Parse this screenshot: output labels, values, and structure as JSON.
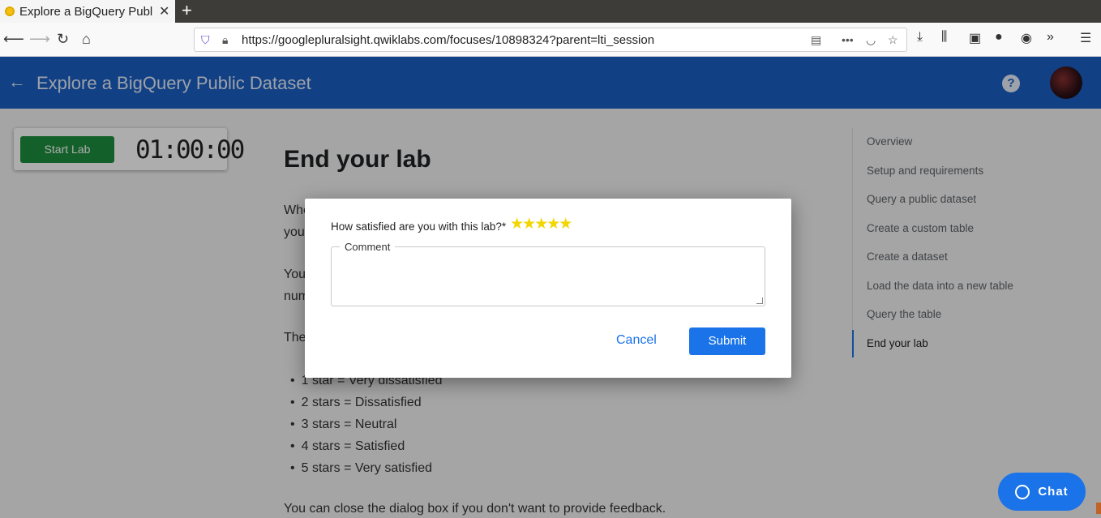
{
  "browser": {
    "tab_title": "Explore a BigQuery Publ",
    "tab_close": "✕",
    "new_tab": "+",
    "url": "https://googlepluralsight.qwiklabs.com/focuses/10898324?parent=lti_session"
  },
  "header": {
    "title": "Explore a BigQuery Public Dataset",
    "help": "?"
  },
  "lab_card": {
    "start_label": "Start Lab",
    "timer": "01:00:00"
  },
  "content": {
    "heading": "End your lab",
    "para1_line1": "Whe",
    "para1_line2": "you",
    "para2_line1": "You",
    "para2_line2": "num",
    "para3": "The",
    "bullets": [
      "1 star = Very dissatisfied",
      "2 stars = Dissatisfied",
      "3 stars = Neutral",
      "4 stars = Satisfied",
      "5 stars = Very satisfied"
    ],
    "closing": "You can close the dialog box if you don't want to provide feedback."
  },
  "toc": {
    "items": [
      "Overview",
      "Setup and requirements",
      "Query a public dataset",
      "Create a custom table",
      "Create a dataset",
      "Load the data into a new table",
      "Query the table",
      "End your lab"
    ],
    "active_index": 7
  },
  "dialog": {
    "question": "How satisfied are you with this lab?*",
    "rating": 5,
    "comment_label": "Comment",
    "comment_value": "",
    "cancel_label": "Cancel",
    "submit_label": "Submit"
  },
  "chat": {
    "label": "Chat"
  },
  "colors": {
    "header_bg": "#1a5fc4",
    "start_btn": "#1e8e3e",
    "primary": "#1a73e8",
    "star": "#f2d600"
  }
}
